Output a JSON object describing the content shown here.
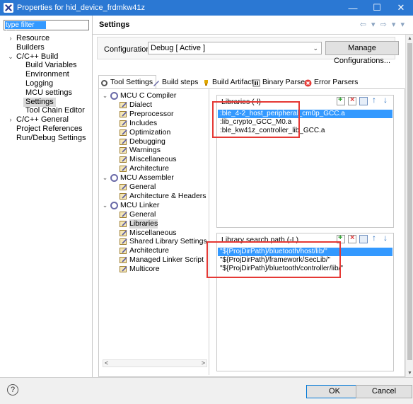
{
  "window": {
    "title": "Properties for hid_device_frdmkw41z"
  },
  "left": {
    "filter_placeholder": "type filter text",
    "items": [
      {
        "label": "Resource",
        "level": 0,
        "arrow": ">"
      },
      {
        "label": "Builders",
        "level": 0
      },
      {
        "label": "C/C++ Build",
        "level": 0,
        "arrow": "v"
      },
      {
        "label": "Build Variables",
        "level": 1
      },
      {
        "label": "Environment",
        "level": 1
      },
      {
        "label": "Logging",
        "level": 1
      },
      {
        "label": "MCU settings",
        "level": 1
      },
      {
        "label": "Settings",
        "level": 1,
        "selected": true
      },
      {
        "label": "Tool Chain Editor",
        "level": 1
      },
      {
        "label": "C/C++ General",
        "level": 0,
        "arrow": ">"
      },
      {
        "label": "Project References",
        "level": 0
      },
      {
        "label": "Run/Debug Settings",
        "level": 0
      }
    ]
  },
  "header": {
    "title": "Settings"
  },
  "configuration": {
    "label": "Configuration:",
    "value": "Debug  [ Active ]",
    "manage_label": "Manage Configurations..."
  },
  "tabs": [
    {
      "label": "Tool Settings",
      "icon": "gear-icon"
    },
    {
      "label": "Build steps",
      "icon": "wrench-icon"
    },
    {
      "label": "Build Artifact",
      "icon": "trophy-icon"
    },
    {
      "label": "Binary Parsers",
      "icon": "binary-icon"
    },
    {
      "label": "Error Parsers",
      "icon": "error-icon"
    }
  ],
  "tool_tree": [
    {
      "label": "MCU C Compiler",
      "kind": "gear",
      "arrow": "v"
    },
    {
      "label": "Dialect",
      "kind": "tool"
    },
    {
      "label": "Preprocessor",
      "kind": "tool"
    },
    {
      "label": "Includes",
      "kind": "tool"
    },
    {
      "label": "Optimization",
      "kind": "tool"
    },
    {
      "label": "Debugging",
      "kind": "tool"
    },
    {
      "label": "Warnings",
      "kind": "tool"
    },
    {
      "label": "Miscellaneous",
      "kind": "tool"
    },
    {
      "label": "Architecture",
      "kind": "tool"
    },
    {
      "label": "MCU Assembler",
      "kind": "gear",
      "arrow": "v"
    },
    {
      "label": "General",
      "kind": "tool"
    },
    {
      "label": "Architecture & Headers",
      "kind": "tool"
    },
    {
      "label": "MCU Linker",
      "kind": "gear",
      "arrow": "v"
    },
    {
      "label": "General",
      "kind": "tool"
    },
    {
      "label": "Libraries",
      "kind": "tool",
      "selected": true
    },
    {
      "label": "Miscellaneous",
      "kind": "tool"
    },
    {
      "label": "Shared Library Settings",
      "kind": "tool"
    },
    {
      "label": "Architecture",
      "kind": "tool"
    },
    {
      "label": "Managed Linker Script",
      "kind": "tool"
    },
    {
      "label": "Multicore",
      "kind": "tool"
    }
  ],
  "libraries": {
    "title": "Libraries (-l)",
    "items": [
      {
        "label": ":ble_4-2_host_peripheral_cm0p_GCC.a",
        "selected": true
      },
      {
        "label": ":lib_crypto_GCC_M0.a"
      },
      {
        "label": ":ble_kw41z_controller_lib_GCC.a"
      }
    ]
  },
  "search_path": {
    "title": "Library search path (-L)",
    "items": [
      {
        "label": "\"${ProjDirPath}/bluetooth/host/lib/\"",
        "selected": true
      },
      {
        "label": "\"${ProjDirPath}/framework/SecLib/\""
      },
      {
        "label": "\"${ProjDirPath}/bluetooth/controller/lib/\""
      }
    ]
  },
  "buttons": {
    "ok": "OK",
    "cancel": "Cancel",
    "help": "?"
  },
  "colors": {
    "titlebar": "#2b78d3",
    "selection": "#3399ff",
    "highlight_box": "#e53935"
  }
}
